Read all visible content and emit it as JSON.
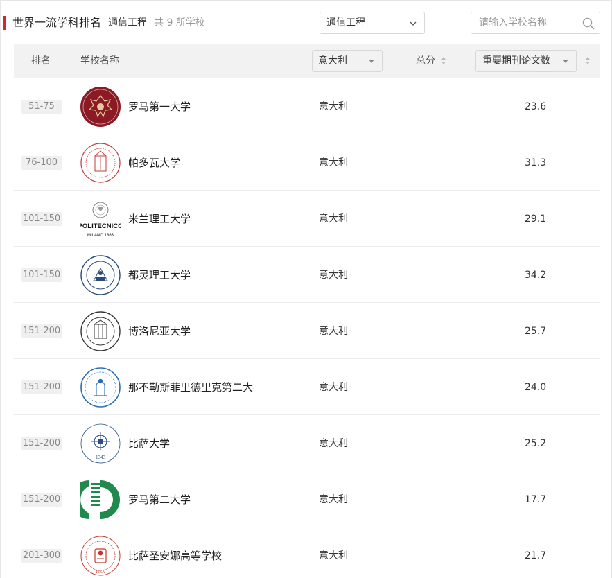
{
  "header": {
    "title": "世界一流学科排名",
    "subject": "通信工程",
    "count_text": "共 9 所学校",
    "subject_select": "通信工程",
    "search_placeholder": "请输入学校名称"
  },
  "table": {
    "columns": {
      "rank": "排名",
      "name": "学校名称",
      "country_filter": "意大利",
      "total": "总分",
      "metric_select": "重要期刊论文数"
    },
    "rows": [
      {
        "rank": "51-75",
        "name": "罗马第一大学",
        "country": "意大利",
        "score": "23.6",
        "logo": "sapienza-seal-icon"
      },
      {
        "rank": "76-100",
        "name": "帕多瓦大学",
        "country": "意大利",
        "score": "31.3",
        "logo": "padova-seal-icon"
      },
      {
        "rank": "101-150",
        "name": "米兰理工大学",
        "country": "意大利",
        "score": "29.1",
        "logo": "polimi-logo-icon"
      },
      {
        "rank": "101-150",
        "name": "都灵理工大学",
        "country": "意大利",
        "score": "34.2",
        "logo": "polito-seal-icon"
      },
      {
        "rank": "151-200",
        "name": "博洛尼亚大学",
        "country": "意大利",
        "score": "25.7",
        "logo": "bologna-seal-icon"
      },
      {
        "rank": "151-200",
        "name": "那不勒斯菲里德里克第二大学",
        "country": "意大利",
        "score": "24.0",
        "logo": "naples-seal-icon"
      },
      {
        "rank": "151-200",
        "name": "比萨大学",
        "country": "意大利",
        "score": "25.2",
        "logo": "pisa-seal-icon"
      },
      {
        "rank": "151-200",
        "name": "罗马第二大学",
        "country": "意大利",
        "score": "17.7",
        "logo": "torvergata-logo-icon"
      },
      {
        "rank": "201-300",
        "name": "比萨圣安娜高等学校",
        "country": "意大利",
        "score": "21.7",
        "logo": "santanna-seal-icon"
      }
    ]
  },
  "logo_text": {
    "polimi": "POLITECNICO",
    "polimi_sub": "MILANO 1863",
    "pisa_year": "1343",
    "santanna": "PISA"
  },
  "colors": {
    "accent": "#d3262e",
    "sapienza": "#8b1a24",
    "padova": "#c33a3a",
    "polito": "#2a4a7a",
    "naples": "#2b6cb0",
    "pisa": "#2a4f88",
    "torvergata": "#1f8a4c",
    "santanna": "#c0392b"
  }
}
